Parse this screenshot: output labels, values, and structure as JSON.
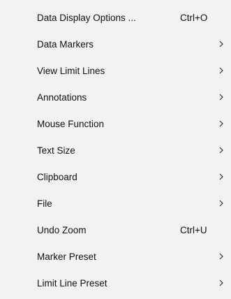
{
  "menu": {
    "items": [
      {
        "label": "Data Display Options ...",
        "shortcut": "Ctrl+O",
        "submenu": false
      },
      {
        "label": "Data Markers",
        "shortcut": "",
        "submenu": true
      },
      {
        "label": "View Limit Lines",
        "shortcut": "",
        "submenu": true
      },
      {
        "label": "Annotations",
        "shortcut": "",
        "submenu": true
      },
      {
        "label": "Mouse Function",
        "shortcut": "",
        "submenu": true
      },
      {
        "label": "Text Size",
        "shortcut": "",
        "submenu": true
      },
      {
        "label": "Clipboard",
        "shortcut": "",
        "submenu": true
      },
      {
        "label": "File",
        "shortcut": "",
        "submenu": true
      },
      {
        "label": "Undo Zoom",
        "shortcut": "Ctrl+U",
        "submenu": false
      },
      {
        "label": "Marker Preset",
        "shortcut": "",
        "submenu": true
      },
      {
        "label": "Limit Line Preset",
        "shortcut": "",
        "submenu": true
      }
    ],
    "submenu_icon": "chevron-right-icon",
    "colors": {
      "background": "#f2f2f2",
      "text": "#111111"
    }
  }
}
